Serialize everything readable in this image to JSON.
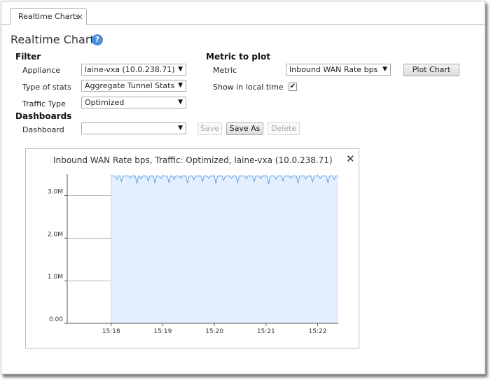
{
  "tab": {
    "label": "Realtime Charts",
    "close": "×"
  },
  "page": {
    "title": "Realtime Charts",
    "help": "?"
  },
  "filter": {
    "heading": "Filter",
    "appliance_label": "Appliance",
    "appliance_value": "laine-vxa (10.0.238.71)",
    "type_label": "Type of stats",
    "type_value": "Aggregate Tunnel Stats",
    "traffic_label": "Traffic Type",
    "traffic_value": "Optimized"
  },
  "metric": {
    "heading": "Metric to plot",
    "metric_label": "Metric",
    "metric_value": "Inbound WAN Rate bps",
    "plot_button": "Plot Chart",
    "local_time_label": "Show in local time",
    "local_time_checked": true
  },
  "dashboards": {
    "heading": "Dashboards",
    "dashboard_label": "Dashboard",
    "dashboard_value": "",
    "save": "Save",
    "save_as": "Save As",
    "delete": "Delete"
  },
  "chart_panel": {
    "title": "Inbound WAN Rate bps, Traffic: Optimized, laine-vxa (10.0.238.71)",
    "close": "✕"
  },
  "chart_data": {
    "type": "area",
    "title": "Inbound WAN Rate bps, Traffic: Optimized, laine-vxa (10.0.238.71)",
    "xlabel": "",
    "ylabel": "",
    "x_ticks": [
      "15:18",
      "15:19",
      "15:20",
      "15:21",
      "15:22"
    ],
    "y_ticks": [
      "0.00",
      "1.0M",
      "2.0M",
      "3.0M"
    ],
    "xlim_minutes": [
      -0.85,
      4.4
    ],
    "ylim": [
      0,
      3500000
    ],
    "series_start_minute": 0.0,
    "series_level": 3460000,
    "dip_minutes": [
      0.11,
      0.2,
      0.37,
      0.5,
      0.58,
      0.72,
      0.85,
      0.96,
      1.12,
      1.22,
      1.35,
      1.48,
      1.6,
      1.77,
      1.89,
      2.03,
      2.18,
      2.33,
      2.45,
      2.62,
      2.77,
      2.9,
      3.05,
      3.19,
      3.33,
      3.48,
      3.62,
      3.77,
      3.9,
      4.05,
      4.2,
      4.32
    ],
    "dip_values": [
      3380000,
      3330000,
      3410000,
      3280000,
      3390000,
      3340000,
      3290000,
      3400000,
      3300000,
      3380000,
      3410000,
      3290000,
      3370000,
      3330000,
      3400000,
      3280000,
      3360000,
      3410000,
      3300000,
      3390000,
      3330000,
      3400000,
      3270000,
      3380000,
      3340000,
      3410000,
      3290000,
      3390000,
      3320000,
      3400000,
      3300000,
      3380000
    ],
    "grid": true,
    "colors": {
      "line": "#5ea0e0",
      "fill": "#e3efff",
      "grid": "#8c8c8c"
    }
  }
}
